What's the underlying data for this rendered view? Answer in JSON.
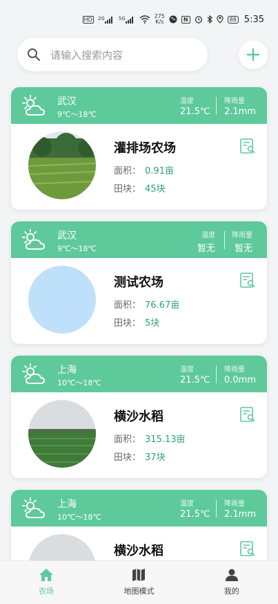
{
  "status_bar": {
    "hd": "HD",
    "net1": "2G",
    "net2": "5G",
    "speed_value": "275",
    "speed_unit": "K/s",
    "nfc": "N",
    "battery": "88",
    "time": "5:35"
  },
  "search": {
    "placeholder": "请输入搜索内容"
  },
  "farms": [
    {
      "city": "武汉",
      "temp_range": "9℃～18℃",
      "temp_label": "温度",
      "temp_value": "21.5℃",
      "rain_label": "降雨量",
      "rain_value": "2.1mm",
      "name": "灌排场农场",
      "area_label": "面积：",
      "area_value": "0.91亩",
      "plots_label": "田块：",
      "plots_value": "45块",
      "photo": "farm-field-photo"
    },
    {
      "city": "武汉",
      "temp_range": "9℃～18℃",
      "temp_label": "温度",
      "temp_value": "暂无",
      "rain_label": "降雨量",
      "rain_value": "暂无",
      "name": "测试农场",
      "area_label": "面积：",
      "area_value": "76.67亩",
      "plots_label": "田块：",
      "plots_value": "5块",
      "photo": "blue-placeholder"
    },
    {
      "city": "上海",
      "temp_range": "10℃～18℃",
      "temp_label": "温度",
      "temp_value": "21.5℃",
      "rain_label": "降雨量",
      "rain_value": "0.0mm",
      "name": "横沙水稻",
      "area_label": "面积：",
      "area_value": "315.13亩",
      "plots_label": "田块：",
      "plots_value": "37块",
      "photo": "rice-field-photo"
    },
    {
      "city": "上海",
      "temp_range": "10℃～18℃",
      "temp_label": "温度",
      "temp_value": "21.5℃",
      "rain_label": "降雨量",
      "rain_value": "2.1mm",
      "name": "横沙水稻",
      "photo": "rice-field-photo"
    }
  ],
  "bottom_nav": {
    "items": [
      {
        "label": "农场",
        "icon": "home-icon",
        "active": true
      },
      {
        "label": "地图模式",
        "icon": "map-icon",
        "active": false
      },
      {
        "label": "我的",
        "icon": "user-icon",
        "active": false
      }
    ]
  },
  "colors": {
    "accent": "#5ec99b",
    "value_green": "#2aa377",
    "placeholder_blue": "#bfe0fb"
  }
}
